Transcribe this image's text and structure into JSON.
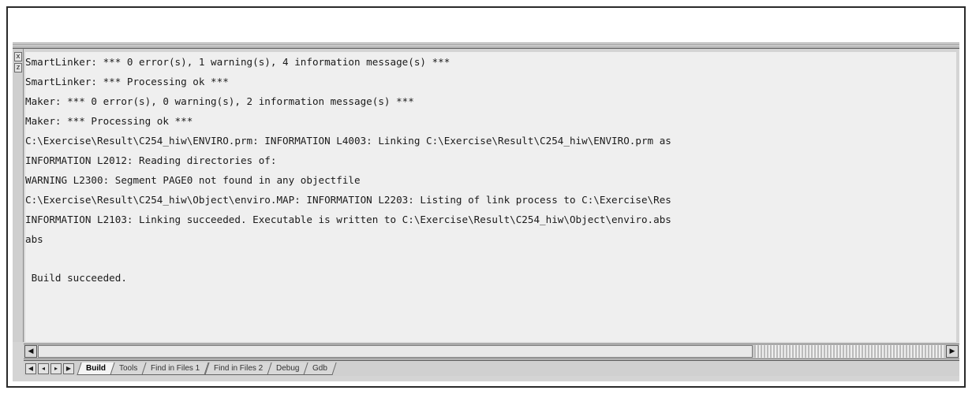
{
  "output_window": {
    "left_grip": {
      "top_button": "x",
      "second_button": "z"
    },
    "log_lines": [
      "SmartLinker: *** 0 error(s), 1 warning(s), 4 information message(s) ***",
      "SmartLinker: *** Processing ok ***",
      "Maker: *** 0 error(s), 0 warning(s), 2 information message(s) ***",
      "Maker: *** Processing ok ***",
      "C:\\Exercise\\Result\\C254_hiw\\ENVIRO.prm: INFORMATION L4003: Linking C:\\Exercise\\Result\\C254_hiw\\ENVIRO.prm as",
      "INFORMATION L2012: Reading directories of:",
      "WARNING L2300: Segment PAGE0 not found in any objectfile",
      "C:\\Exercise\\Result\\C254_hiw\\Object\\enviro.MAP: INFORMATION L2203: Listing of link process to C:\\Exercise\\Res",
      "INFORMATION L2103: Linking succeeded. Executable is written to C:\\Exercise\\Result\\C254_hiw\\Object\\enviro.abs",
      "abs"
    ],
    "build_status": " Build succeeded.",
    "scrollbar": {
      "left_arrow_icon": "arrow-left-icon",
      "right_arrow_icon": "arrow-right-icon"
    },
    "tab_nav_icons": [
      "first-tab-icon",
      "prev-tab-icon",
      "next-tab-icon",
      "last-tab-icon"
    ],
    "tabs": [
      {
        "label": "Build",
        "active": true
      },
      {
        "label": "Tools",
        "active": false
      },
      {
        "label": "Find in Files 1",
        "active": false
      },
      {
        "label": "Find in Files 2",
        "active": false
      },
      {
        "label": "Debug",
        "active": false
      },
      {
        "label": "Gdb",
        "active": false
      }
    ]
  }
}
